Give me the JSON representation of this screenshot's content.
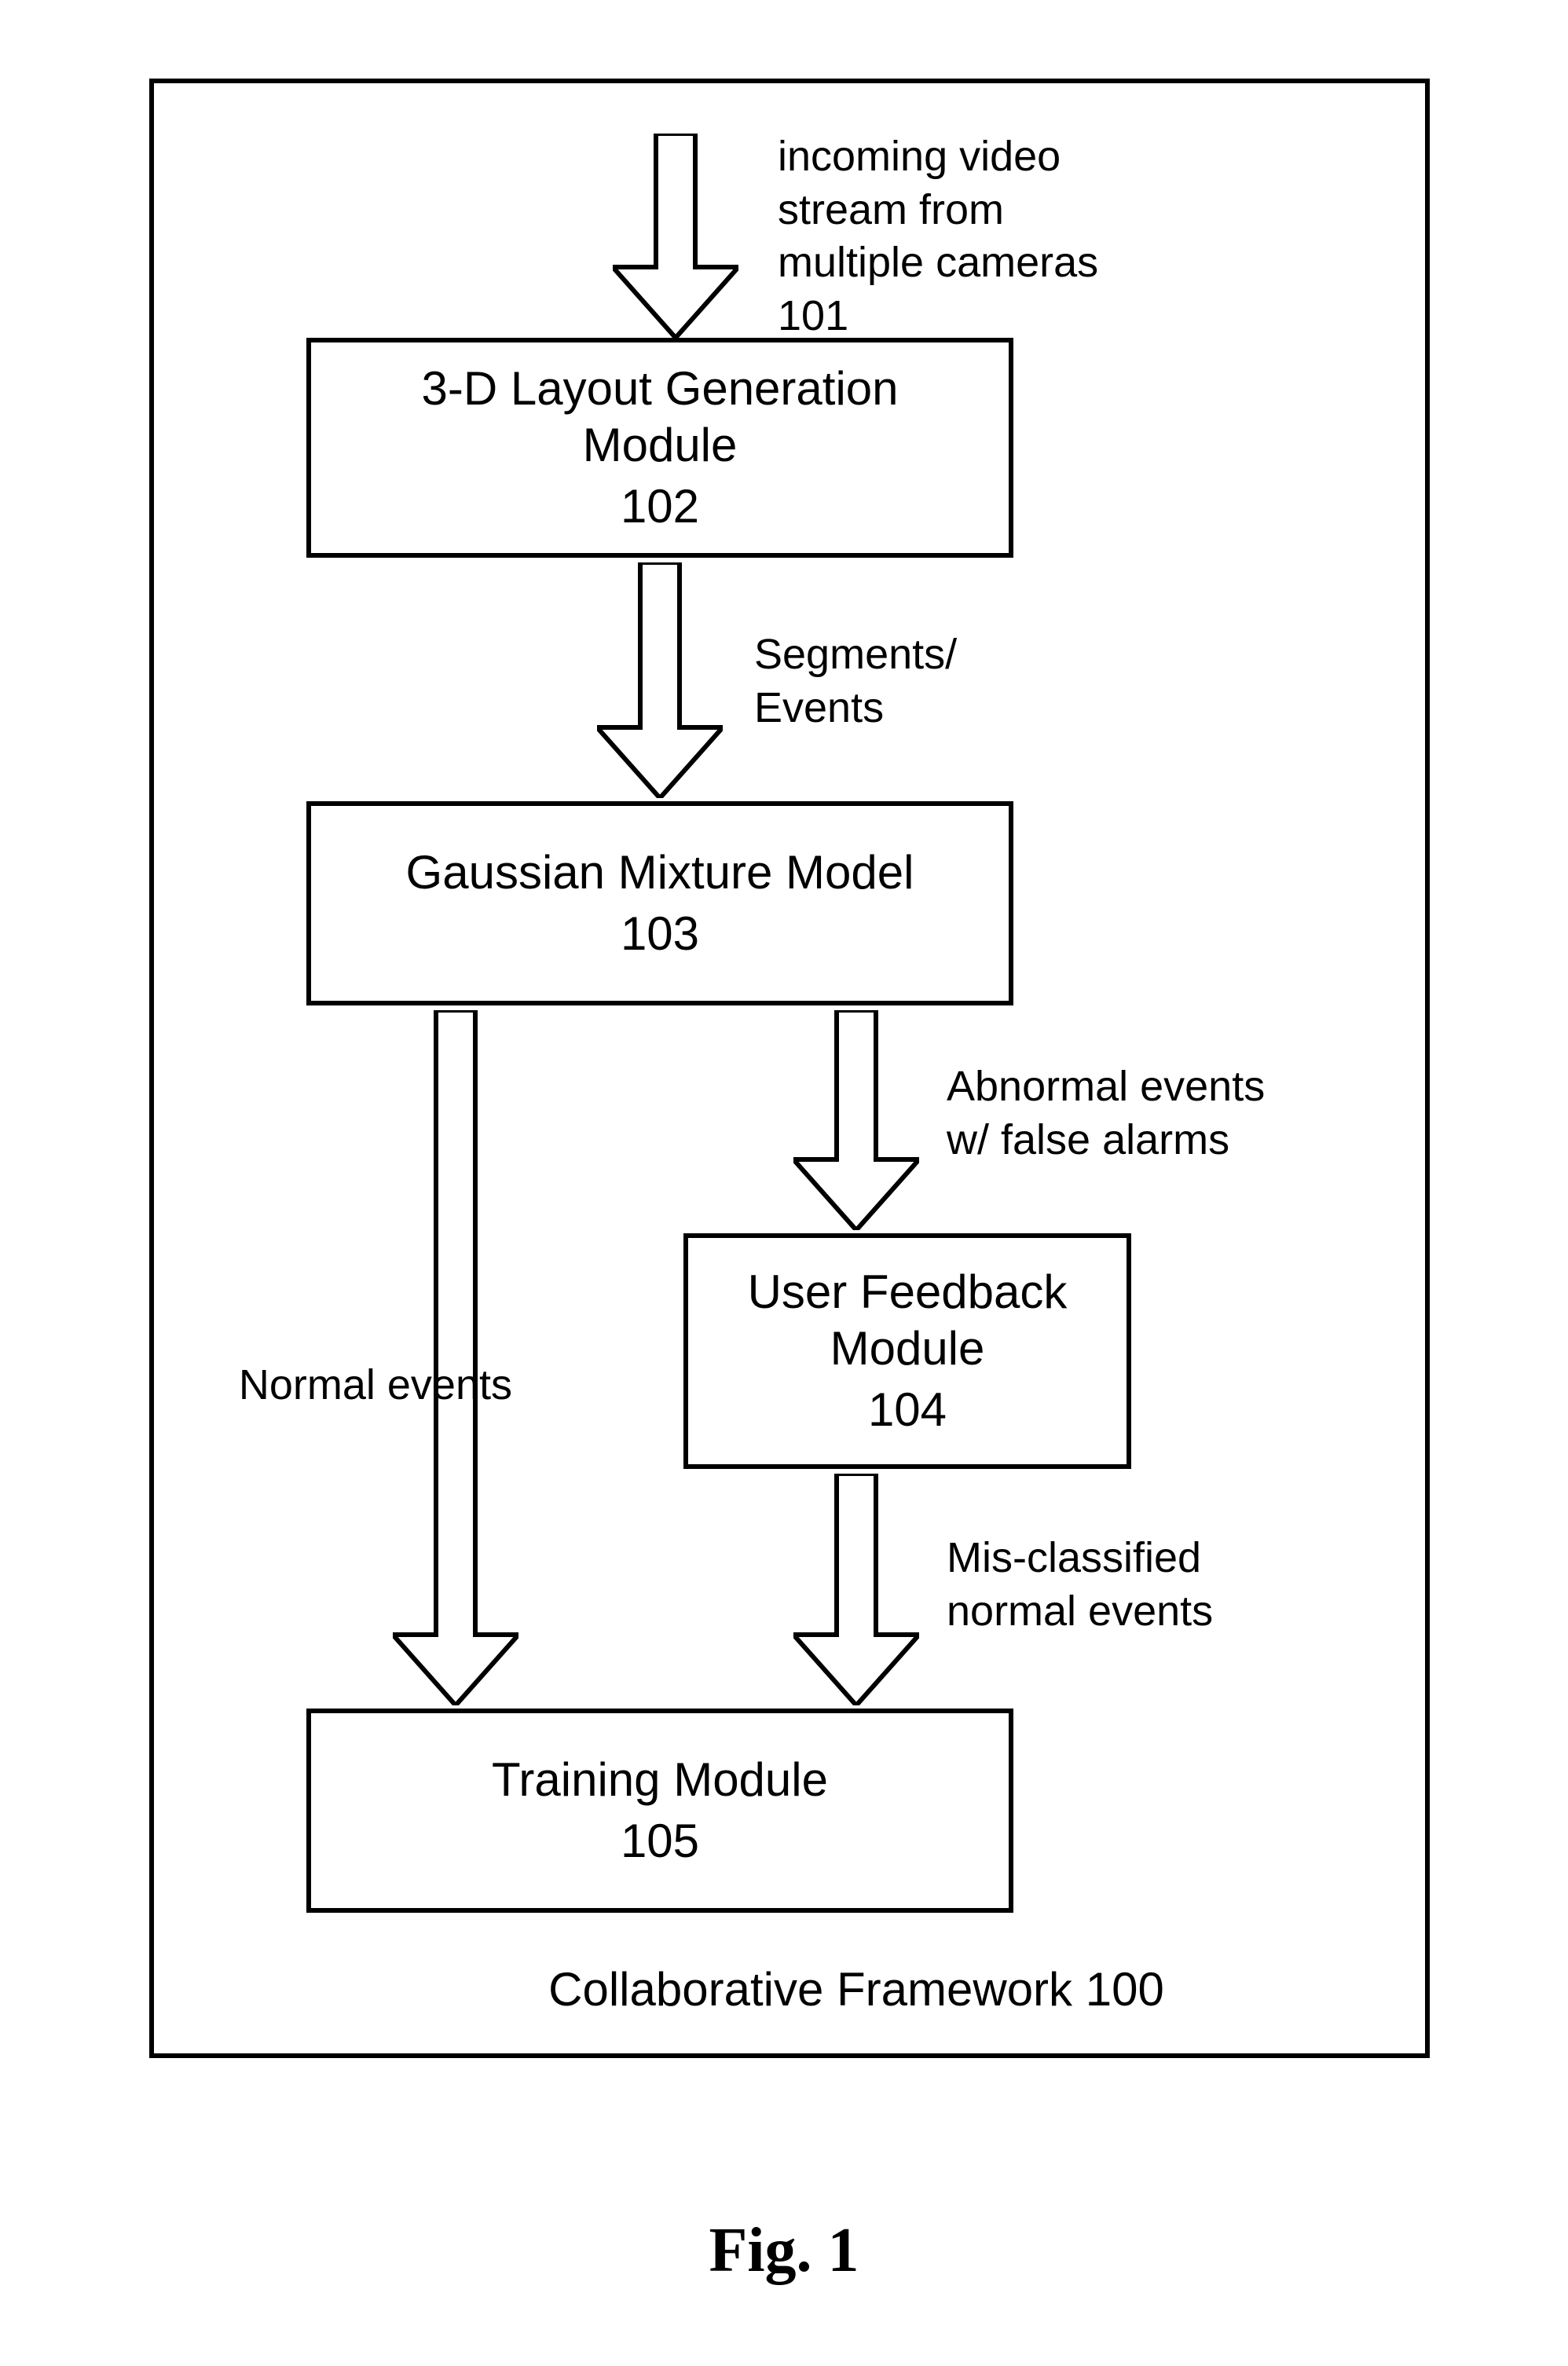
{
  "input_label": "incoming video\nstream from\nmultiple cameras\n101",
  "box_102": {
    "title": "3-D Layout Generation\nModule",
    "num": "102"
  },
  "edge_102_103": "Segments/\nEvents",
  "box_103": {
    "title": "Gaussian Mixture Model",
    "num": "103"
  },
  "edge_103_left": "Normal events",
  "edge_103_right": "Abnormal events\nw/ false alarms",
  "box_104": {
    "title": "User Feedback\nModule",
    "num": "104"
  },
  "edge_104_105": "Mis-classified\nnormal events",
  "box_105": {
    "title": "Training Module",
    "num": "105"
  },
  "framework_caption": "Collaborative Framework 100",
  "figure_caption": "Fig. 1"
}
